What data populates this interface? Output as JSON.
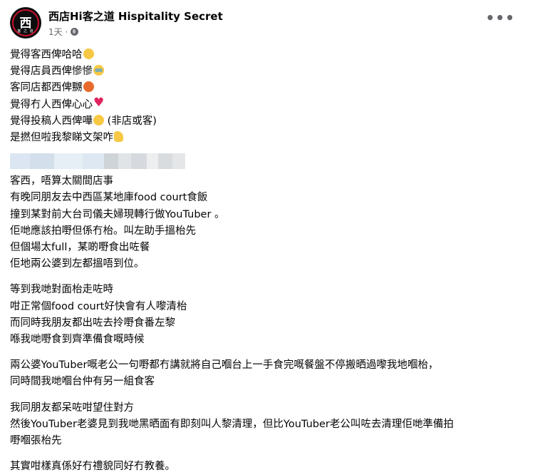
{
  "page": {
    "name": "西店Hi客之道 Hispitality Secret",
    "time": "1天",
    "more_label": "•••",
    "avatar_mark": "西",
    "avatar_small": "客 之 道"
  },
  "post": {
    "lines": [
      "覺得客西俾哈哈",
      "覺得店員西俾慘慘",
      "客同店都西俾嬲",
      "覺得冇人西俾心心",
      "覺得投稿人西俾嘩",
      "(非店或客)",
      "是撚但啦我黎睇文架咋"
    ],
    "p1": [
      "客西，唔算太關間店事",
      "有晚同朋友去中西區某地庫food court食飯",
      "撞到某對前大台司儀夫婦現轉行做YouTuber  。",
      "佢哋應該拍嘢但係冇枱。叫左助手搵枱先",
      "但個場太full，某啲嘢食出咗餐",
      "佢地兩公婆到左都搵唔到位。"
    ],
    "p2": [
      "等到我哋對面枱走咗時",
      "咁正常個food court好快會有人嚟清枱",
      "而同時我朋友都出咗去拎嘢食番左黎",
      "喺我哋嘢食到齊準備食嘅時候"
    ],
    "p3": [
      "兩公婆YouTuber嘅老公一句嘢都冇講就將自己嗰台上一手食完嘅餐盤不停搬晒過嚟我地嗰枱，",
      "同時間我哋嗰台仲有另一組食客"
    ],
    "p4": [
      "我同朋友都呆咗咁望住對方",
      "然後YouTuber老婆見到我哋黑晒面有即刻叫人黎清理，但比YouTuber老公叫咗去清理佢哋準備拍",
      "嘢嗰張枱先"
    ],
    "p5": [
      "其實咁樣真係好冇禮貌同好冇教養。"
    ]
  },
  "colors": {
    "text": "#050505",
    "secondary": "#65676b",
    "brand_red": "#c8102e"
  }
}
